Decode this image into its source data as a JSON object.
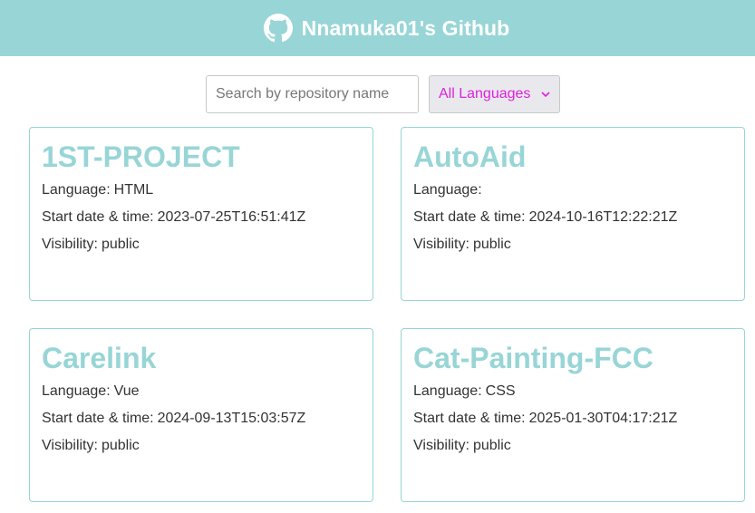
{
  "header": {
    "title": "Nnamuka01's Github",
    "icon": "github-icon",
    "background": "#98d5d6"
  },
  "filters": {
    "search_placeholder": "Search by repository name",
    "search_value": "",
    "language_selected": "All Languages"
  },
  "labels": {
    "language": "Language:",
    "start": "Start date & time:",
    "visibility": "Visibility:"
  },
  "repos": [
    {
      "name": "1ST-PROJECT",
      "language": "HTML",
      "start": "2023-07-25T16:51:41Z",
      "visibility": "public"
    },
    {
      "name": "AutoAid",
      "language": "",
      "start": "2024-10-16T12:22:21Z",
      "visibility": "public"
    },
    {
      "name": "Carelink",
      "language": "Vue",
      "start": "2024-09-13T15:03:57Z",
      "visibility": "public"
    },
    {
      "name": "Cat-Painting-FCC",
      "language": "CSS",
      "start": "2025-01-30T04:17:21Z",
      "visibility": "public"
    }
  ],
  "colors": {
    "accent": "#98d5d6",
    "select_text": "#e020e0"
  }
}
